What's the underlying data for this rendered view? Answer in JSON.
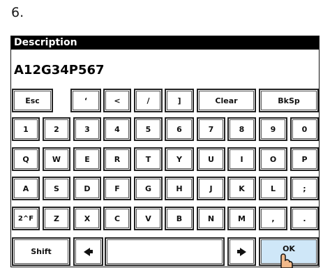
{
  "step_number": "6.",
  "dialog": {
    "title": "Description",
    "value": "A12G34P567"
  },
  "keyboard": {
    "row1": [
      "Esc",
      "‘",
      "<",
      "/",
      "]",
      "Clear",
      "BkSp"
    ],
    "row2": [
      "1",
      "2",
      "3",
      "4",
      "5",
      "6",
      "7",
      "8",
      "9",
      "0"
    ],
    "row3": [
      "Q",
      "W",
      "E",
      "R",
      "T",
      "Y",
      "U",
      "I",
      "O",
      "P"
    ],
    "row4": [
      "A",
      "S",
      "D",
      "F",
      "G",
      "H",
      "J",
      "K",
      "L",
      ";"
    ],
    "row5": [
      "2^F",
      "Z",
      "X",
      "C",
      "V",
      "B",
      "N",
      "M",
      ",",
      "."
    ],
    "row6": {
      "shift": "Shift",
      "left_icon": "arrow-left-icon",
      "right_icon": "arrow-right-icon",
      "ok": "OK"
    }
  },
  "colors": {
    "title_bg": "#000000",
    "ok_bg": "#cfe7f8"
  }
}
